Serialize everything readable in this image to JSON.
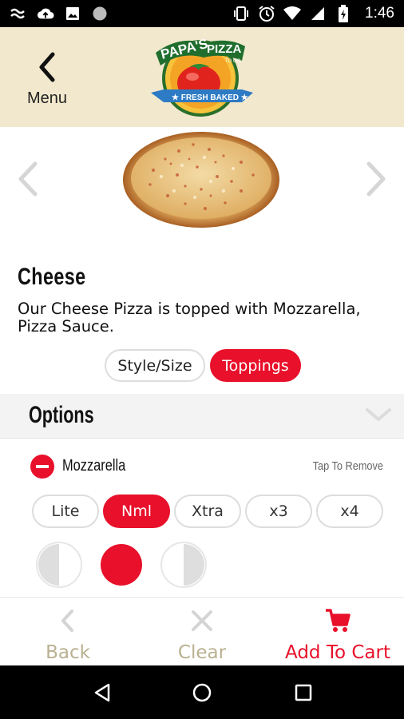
{
  "status_bar": {
    "time": "1:46"
  },
  "header": {
    "back_label": "Menu"
  },
  "product": {
    "name": "Cheese",
    "description": "Our Cheese Pizza is topped with Mozzarella, Pizza Sauce."
  },
  "tabs": [
    {
      "label": "Style/Size"
    },
    {
      "label": "Toppings"
    }
  ],
  "options": {
    "title": "Options",
    "topping": {
      "name": "Mozzarella",
      "hint": "Tap To Remove",
      "amounts": [
        {
          "label": "Lite"
        },
        {
          "label": "Nml"
        },
        {
          "label": "Xtra"
        },
        {
          "label": "x3"
        },
        {
          "label": "x4"
        }
      ],
      "selected_amount": "Nml"
    }
  },
  "bottom_bar": {
    "back": "Back",
    "clear": "Clear",
    "add_to_cart": "Add To Cart"
  },
  "colors": {
    "accent": "#e8102a",
    "header_bg": "#f1e8cd",
    "muted_label": "#b9b191"
  }
}
